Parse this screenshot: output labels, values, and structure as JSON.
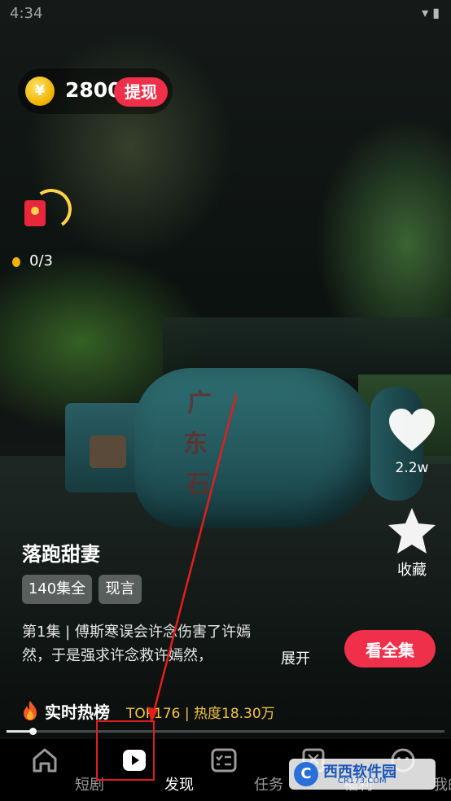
{
  "status_bar": {
    "time": "4:34",
    "icons": "▾ ▮"
  },
  "rewards": {
    "coin_symbol": "¥",
    "coins": "2800",
    "withdraw_label": "提现",
    "progress": "0/3"
  },
  "actions": {
    "like_count": "2.2w",
    "collect_label": "收藏"
  },
  "drama": {
    "title": "落跑甜妻",
    "tags": [
      "140集全",
      "现言"
    ],
    "description": "第1集 | 傅斯寒误会许念伤害了许嫣然，于是强求许念救许嫣然，",
    "expand_label": "展开",
    "watch_all_label": "看全集"
  },
  "hot": {
    "title": "实时热榜",
    "rank": "TOP176 | 热度18.30万"
  },
  "tank_text": [
    "广",
    "东",
    "石"
  ],
  "playback": {
    "progress": 0.06
  },
  "tabs": [
    {
      "label": "短剧",
      "icon": "home-icon"
    },
    {
      "label": "发现",
      "icon": "play-icon"
    },
    {
      "label": "任务",
      "icon": "task-icon"
    },
    {
      "label": "福利",
      "icon": "gift-icon"
    },
    {
      "label": "我的",
      "icon": "profile-icon"
    }
  ],
  "active_tab": 1,
  "watermark": {
    "logo": "C",
    "name": "西西软件园",
    "site": "CR173.COM"
  },
  "colors": {
    "accent": "#f0304a",
    "gold": "#f5c542",
    "annotation": "#e21e1e"
  }
}
